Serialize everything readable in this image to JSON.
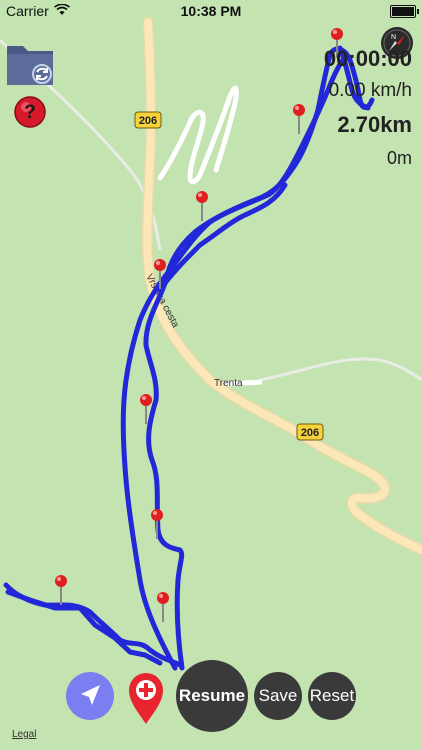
{
  "status_bar": {
    "carrier": "Carrier",
    "time": "10:38 PM"
  },
  "stats": {
    "elapsed_time": "00:00:00",
    "speed": "0.00 km/h",
    "distance": "2.70km",
    "altitude": "0m"
  },
  "map": {
    "road_labels": [
      "206",
      "206"
    ],
    "street_name": "Vršiška cesta",
    "place_name": "Trenta"
  },
  "buttons": {
    "resume": "Resume",
    "save": "Save",
    "reset": "Reset",
    "legal": "Legal"
  },
  "colors": {
    "track": "#2228d8",
    "map_background": "#c3e3b0",
    "road_main": "#fbe7b8",
    "road_minor": "#ffffff",
    "pin": "#e02020",
    "locate_button": "#7a7ef0",
    "round_button": "#3a3a3a"
  },
  "icons": {
    "folder": "folder-sync-icon",
    "help": "question-mark-icon",
    "compass": "compass-icon",
    "locate": "location-arrow-icon",
    "waypoint": "map-pin-plus-icon",
    "pin": "map-pin-icon"
  }
}
